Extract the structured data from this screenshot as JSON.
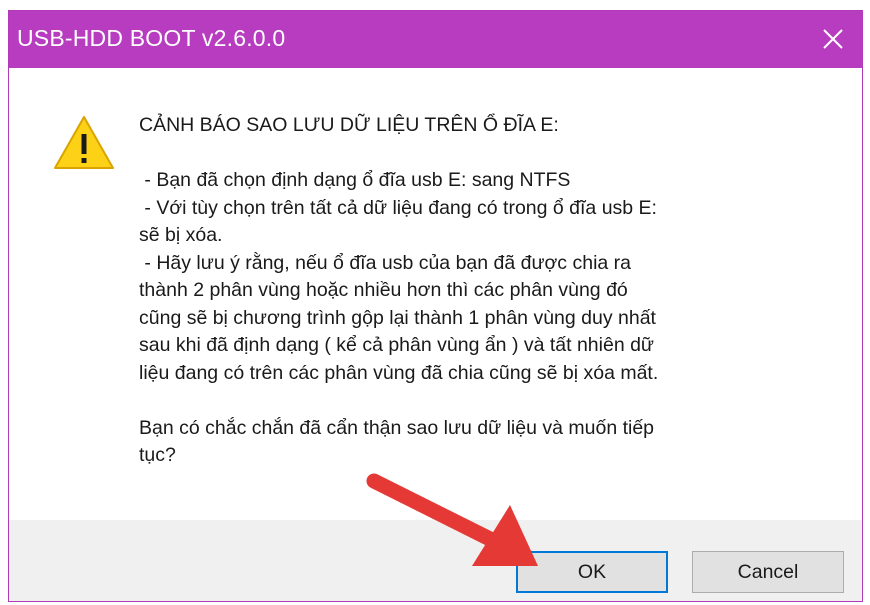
{
  "window": {
    "title": "USB-HDD BOOT v2.6.0.0",
    "titlebar_color": "#b83cbf",
    "close_icon": "close-icon"
  },
  "message": {
    "icon": "warning-icon",
    "lines": [
      "CẢNH BÁO SAO LƯU DỮ LIỆU TRÊN Ổ ĐĨA E:",
      "",
      " - Bạn đã chọn định dạng ổ đĩa usb E: sang NTFS",
      " - Với tùy chọn trên tất cả dữ liệu đang có trong ổ đĩa usb E:",
      "sẽ bị xóa.",
      " - Hãy lưu ý rằng, nếu ổ đĩa usb của bạn đã được chia ra",
      "thành 2 phân vùng hoặc nhiều hơn thì các phân vùng đó",
      "cũng sẽ bị chương trình gộp lại thành 1 phân vùng duy nhất",
      "sau khi đã định dạng ( kể cả phân vùng ẩn ) và tất nhiên dữ",
      "liệu đang có trên các phân vùng đã chia cũng sẽ bị xóa mất.",
      "",
      "Bạn có chắc chắn đã cẩn thận sao lưu dữ liệu và muốn tiếp",
      "tục?"
    ]
  },
  "buttons": {
    "ok_label": "OK",
    "cancel_label": "Cancel"
  },
  "annotation": {
    "arrow_color": "#e53935",
    "arrow_icon": "pointer-arrow-icon"
  }
}
